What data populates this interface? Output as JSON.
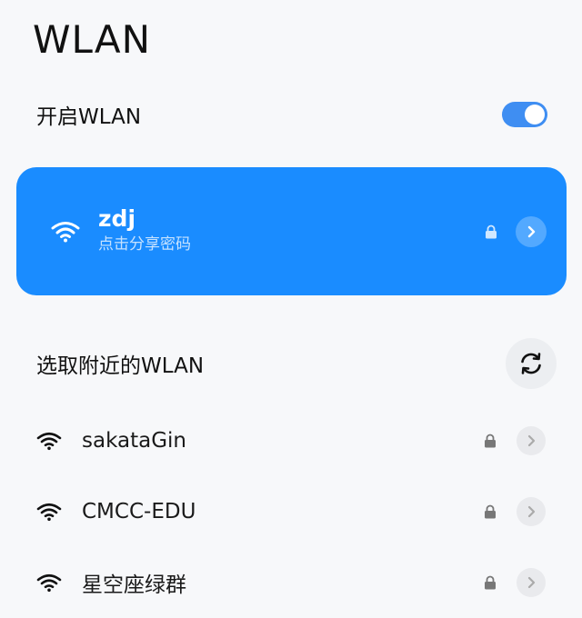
{
  "page": {
    "title": "WLAN"
  },
  "wlan_toggle": {
    "label": "开启WLAN",
    "on": true
  },
  "connected": {
    "ssid": "zdj",
    "subtitle": "点击分享密码"
  },
  "nearby": {
    "title": "选取附近的WLAN",
    "networks": [
      {
        "ssid": "sakataGin",
        "secured": true
      },
      {
        "ssid": "CMCC-EDU",
        "secured": true
      },
      {
        "ssid": "星空座绿群",
        "secured": true
      }
    ]
  },
  "icons": {
    "wifi": "wifi-icon",
    "lock": "lock-icon",
    "chevron": "chevron-right-icon",
    "refresh": "refresh-icon"
  },
  "colors": {
    "accent": "#1a8cff",
    "toggle_on": "#3f8ef2",
    "background": "#f7f8fa",
    "text": "#111111"
  }
}
